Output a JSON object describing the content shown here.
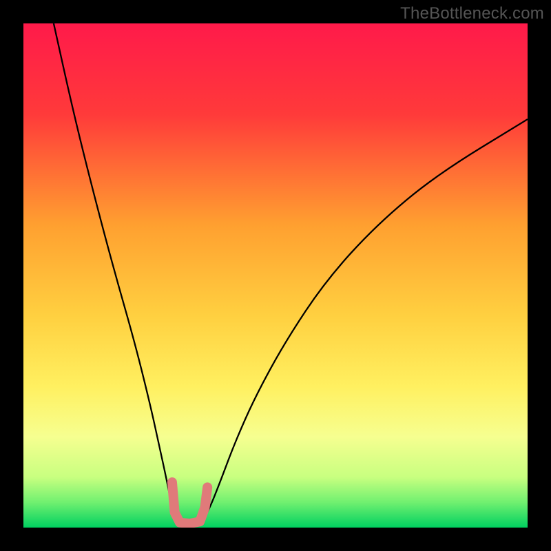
{
  "watermark": "TheBottleneck.com",
  "chart_data": {
    "type": "line",
    "title": "",
    "xlabel": "",
    "ylabel": "",
    "xlim": [
      0,
      100
    ],
    "ylim": [
      0,
      100
    ],
    "gradient_stops": [
      {
        "offset": 0,
        "color": "#ff1a4a"
      },
      {
        "offset": 18,
        "color": "#ff3a3a"
      },
      {
        "offset": 40,
        "color": "#ffa030"
      },
      {
        "offset": 58,
        "color": "#ffd040"
      },
      {
        "offset": 72,
        "color": "#fff060"
      },
      {
        "offset": 82,
        "color": "#f6ff90"
      },
      {
        "offset": 90,
        "color": "#c8ff80"
      },
      {
        "offset": 95,
        "color": "#70f070"
      },
      {
        "offset": 100,
        "color": "#00d060"
      }
    ],
    "series": [
      {
        "name": "bottleneck-curve",
        "stroke": "#000000",
        "width": 2.3,
        "points": [
          {
            "x": 6,
            "y": 100
          },
          {
            "x": 10,
            "y": 82
          },
          {
            "x": 14,
            "y": 66
          },
          {
            "x": 18,
            "y": 51
          },
          {
            "x": 22,
            "y": 37
          },
          {
            "x": 25,
            "y": 25
          },
          {
            "x": 27,
            "y": 16
          },
          {
            "x": 28.5,
            "y": 9
          },
          {
            "x": 29.5,
            "y": 4
          },
          {
            "x": 30.5,
            "y": 1.2
          },
          {
            "x": 32,
            "y": 0.4
          },
          {
            "x": 34,
            "y": 0.4
          },
          {
            "x": 35.5,
            "y": 1.2
          },
          {
            "x": 37,
            "y": 4
          },
          {
            "x": 39,
            "y": 9
          },
          {
            "x": 42,
            "y": 17
          },
          {
            "x": 46,
            "y": 26
          },
          {
            "x": 52,
            "y": 37
          },
          {
            "x": 60,
            "y": 49
          },
          {
            "x": 70,
            "y": 60
          },
          {
            "x": 82,
            "y": 70
          },
          {
            "x": 100,
            "y": 81
          }
        ]
      },
      {
        "name": "highlight-segment",
        "stroke": "#e07a7a",
        "width": 14,
        "linecap": "round",
        "points": [
          {
            "x": 29.5,
            "y": 9
          },
          {
            "x": 30,
            "y": 3
          },
          {
            "x": 31,
            "y": 1
          },
          {
            "x": 33,
            "y": 0.8
          },
          {
            "x": 35,
            "y": 1.2
          },
          {
            "x": 36,
            "y": 4
          },
          {
            "x": 36.5,
            "y": 8
          }
        ]
      }
    ]
  }
}
